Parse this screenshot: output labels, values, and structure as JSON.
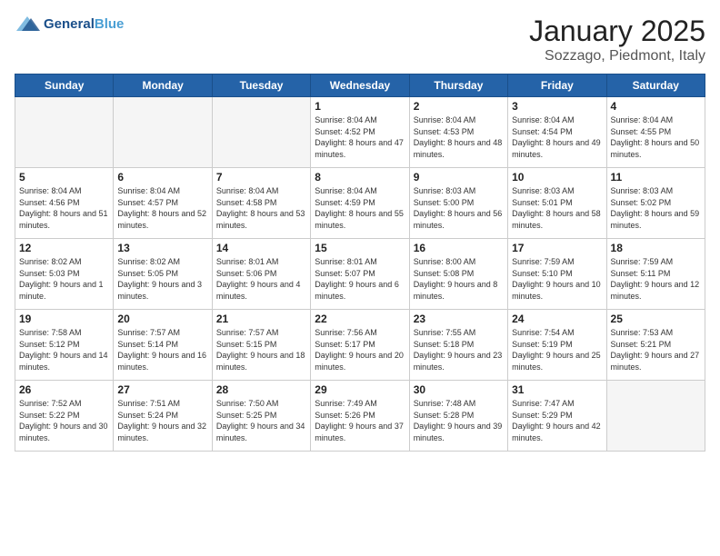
{
  "header": {
    "logo_line1": "General",
    "logo_line2": "Blue",
    "title": "January 2025",
    "subtitle": "Sozzago, Piedmont, Italy"
  },
  "days_of_week": [
    "Sunday",
    "Monday",
    "Tuesday",
    "Wednesday",
    "Thursday",
    "Friday",
    "Saturday"
  ],
  "weeks": [
    [
      {
        "num": "",
        "info": ""
      },
      {
        "num": "",
        "info": ""
      },
      {
        "num": "",
        "info": ""
      },
      {
        "num": "1",
        "info": "Sunrise: 8:04 AM\nSunset: 4:52 PM\nDaylight: 8 hours and 47 minutes."
      },
      {
        "num": "2",
        "info": "Sunrise: 8:04 AM\nSunset: 4:53 PM\nDaylight: 8 hours and 48 minutes."
      },
      {
        "num": "3",
        "info": "Sunrise: 8:04 AM\nSunset: 4:54 PM\nDaylight: 8 hours and 49 minutes."
      },
      {
        "num": "4",
        "info": "Sunrise: 8:04 AM\nSunset: 4:55 PM\nDaylight: 8 hours and 50 minutes."
      }
    ],
    [
      {
        "num": "5",
        "info": "Sunrise: 8:04 AM\nSunset: 4:56 PM\nDaylight: 8 hours and 51 minutes."
      },
      {
        "num": "6",
        "info": "Sunrise: 8:04 AM\nSunset: 4:57 PM\nDaylight: 8 hours and 52 minutes."
      },
      {
        "num": "7",
        "info": "Sunrise: 8:04 AM\nSunset: 4:58 PM\nDaylight: 8 hours and 53 minutes."
      },
      {
        "num": "8",
        "info": "Sunrise: 8:04 AM\nSunset: 4:59 PM\nDaylight: 8 hours and 55 minutes."
      },
      {
        "num": "9",
        "info": "Sunrise: 8:03 AM\nSunset: 5:00 PM\nDaylight: 8 hours and 56 minutes."
      },
      {
        "num": "10",
        "info": "Sunrise: 8:03 AM\nSunset: 5:01 PM\nDaylight: 8 hours and 58 minutes."
      },
      {
        "num": "11",
        "info": "Sunrise: 8:03 AM\nSunset: 5:02 PM\nDaylight: 8 hours and 59 minutes."
      }
    ],
    [
      {
        "num": "12",
        "info": "Sunrise: 8:02 AM\nSunset: 5:03 PM\nDaylight: 9 hours and 1 minute."
      },
      {
        "num": "13",
        "info": "Sunrise: 8:02 AM\nSunset: 5:05 PM\nDaylight: 9 hours and 3 minutes."
      },
      {
        "num": "14",
        "info": "Sunrise: 8:01 AM\nSunset: 5:06 PM\nDaylight: 9 hours and 4 minutes."
      },
      {
        "num": "15",
        "info": "Sunrise: 8:01 AM\nSunset: 5:07 PM\nDaylight: 9 hours and 6 minutes."
      },
      {
        "num": "16",
        "info": "Sunrise: 8:00 AM\nSunset: 5:08 PM\nDaylight: 9 hours and 8 minutes."
      },
      {
        "num": "17",
        "info": "Sunrise: 7:59 AM\nSunset: 5:10 PM\nDaylight: 9 hours and 10 minutes."
      },
      {
        "num": "18",
        "info": "Sunrise: 7:59 AM\nSunset: 5:11 PM\nDaylight: 9 hours and 12 minutes."
      }
    ],
    [
      {
        "num": "19",
        "info": "Sunrise: 7:58 AM\nSunset: 5:12 PM\nDaylight: 9 hours and 14 minutes."
      },
      {
        "num": "20",
        "info": "Sunrise: 7:57 AM\nSunset: 5:14 PM\nDaylight: 9 hours and 16 minutes."
      },
      {
        "num": "21",
        "info": "Sunrise: 7:57 AM\nSunset: 5:15 PM\nDaylight: 9 hours and 18 minutes."
      },
      {
        "num": "22",
        "info": "Sunrise: 7:56 AM\nSunset: 5:17 PM\nDaylight: 9 hours and 20 minutes."
      },
      {
        "num": "23",
        "info": "Sunrise: 7:55 AM\nSunset: 5:18 PM\nDaylight: 9 hours and 23 minutes."
      },
      {
        "num": "24",
        "info": "Sunrise: 7:54 AM\nSunset: 5:19 PM\nDaylight: 9 hours and 25 minutes."
      },
      {
        "num": "25",
        "info": "Sunrise: 7:53 AM\nSunset: 5:21 PM\nDaylight: 9 hours and 27 minutes."
      }
    ],
    [
      {
        "num": "26",
        "info": "Sunrise: 7:52 AM\nSunset: 5:22 PM\nDaylight: 9 hours and 30 minutes."
      },
      {
        "num": "27",
        "info": "Sunrise: 7:51 AM\nSunset: 5:24 PM\nDaylight: 9 hours and 32 minutes."
      },
      {
        "num": "28",
        "info": "Sunrise: 7:50 AM\nSunset: 5:25 PM\nDaylight: 9 hours and 34 minutes."
      },
      {
        "num": "29",
        "info": "Sunrise: 7:49 AM\nSunset: 5:26 PM\nDaylight: 9 hours and 37 minutes."
      },
      {
        "num": "30",
        "info": "Sunrise: 7:48 AM\nSunset: 5:28 PM\nDaylight: 9 hours and 39 minutes."
      },
      {
        "num": "31",
        "info": "Sunrise: 7:47 AM\nSunset: 5:29 PM\nDaylight: 9 hours and 42 minutes."
      },
      {
        "num": "",
        "info": ""
      }
    ]
  ]
}
